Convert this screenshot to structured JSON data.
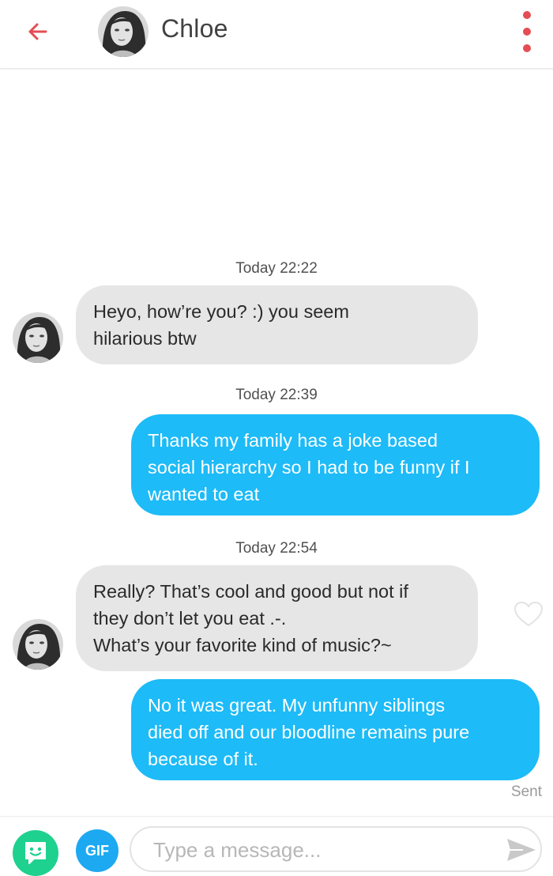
{
  "header": {
    "contact_name": "Chloe",
    "back_icon": "arrow-left-icon",
    "menu_icon": "more-vertical-icon",
    "accent_color": "#e44d54"
  },
  "messages": [
    {
      "type": "timestamp",
      "text": "Today 22:22"
    },
    {
      "type": "incoming",
      "text": "Heyo, how’re you? :) you seem\nhilarious btw"
    },
    {
      "type": "timestamp",
      "text": "Today 22:39"
    },
    {
      "type": "outgoing",
      "text": "Thanks my family has a joke based\nsocial hierarchy so I had to be funny if I\nwanted to eat"
    },
    {
      "type": "timestamp",
      "text": "Today 22:54"
    },
    {
      "type": "incoming",
      "text": "Really? That’s cool and good but not if\nthey don’t let you eat .-.\nWhat’s your favorite kind of music?~"
    },
    {
      "type": "outgoing",
      "text": "No it was great. My unfunny siblings\ndied off and our bloodline remains pure\nbecause of it."
    }
  ],
  "status": {
    "sent_label": "Sent"
  },
  "composer": {
    "gif_label": "GIF",
    "placeholder": "Type a message...",
    "sticker_icon": "sticker-icon",
    "send_icon": "send-icon"
  },
  "colors": {
    "incoming_bubble": "#e6e6e6",
    "outgoing_bubble": "#1dbbf7",
    "sticker_button": "#1ed18f",
    "gif_button": "#1da9f2"
  }
}
